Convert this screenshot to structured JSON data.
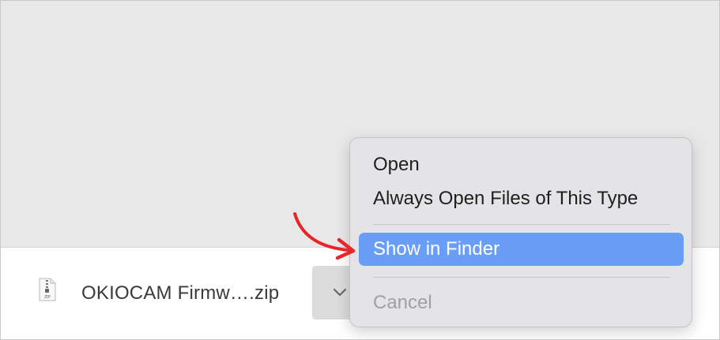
{
  "download_bar": {
    "file_name": "OKIOCAM Firmw….zip",
    "file_icon": "zip-file-icon",
    "menu_button_icon": "chevron-down-icon"
  },
  "context_menu": {
    "items": [
      {
        "label": "Open",
        "state": "normal"
      },
      {
        "label": "Always Open Files of This Type",
        "state": "normal"
      },
      {
        "label": "Show in Finder",
        "state": "highlighted"
      },
      {
        "label": "Cancel",
        "state": "disabled"
      }
    ]
  },
  "annotation": {
    "icon": "red-arrow-annotation-icon",
    "color": "#e8262a"
  },
  "colors": {
    "highlight": "#6a9df5",
    "page_background": "#e8e8e8",
    "menu_background": "#e4e4e6"
  }
}
